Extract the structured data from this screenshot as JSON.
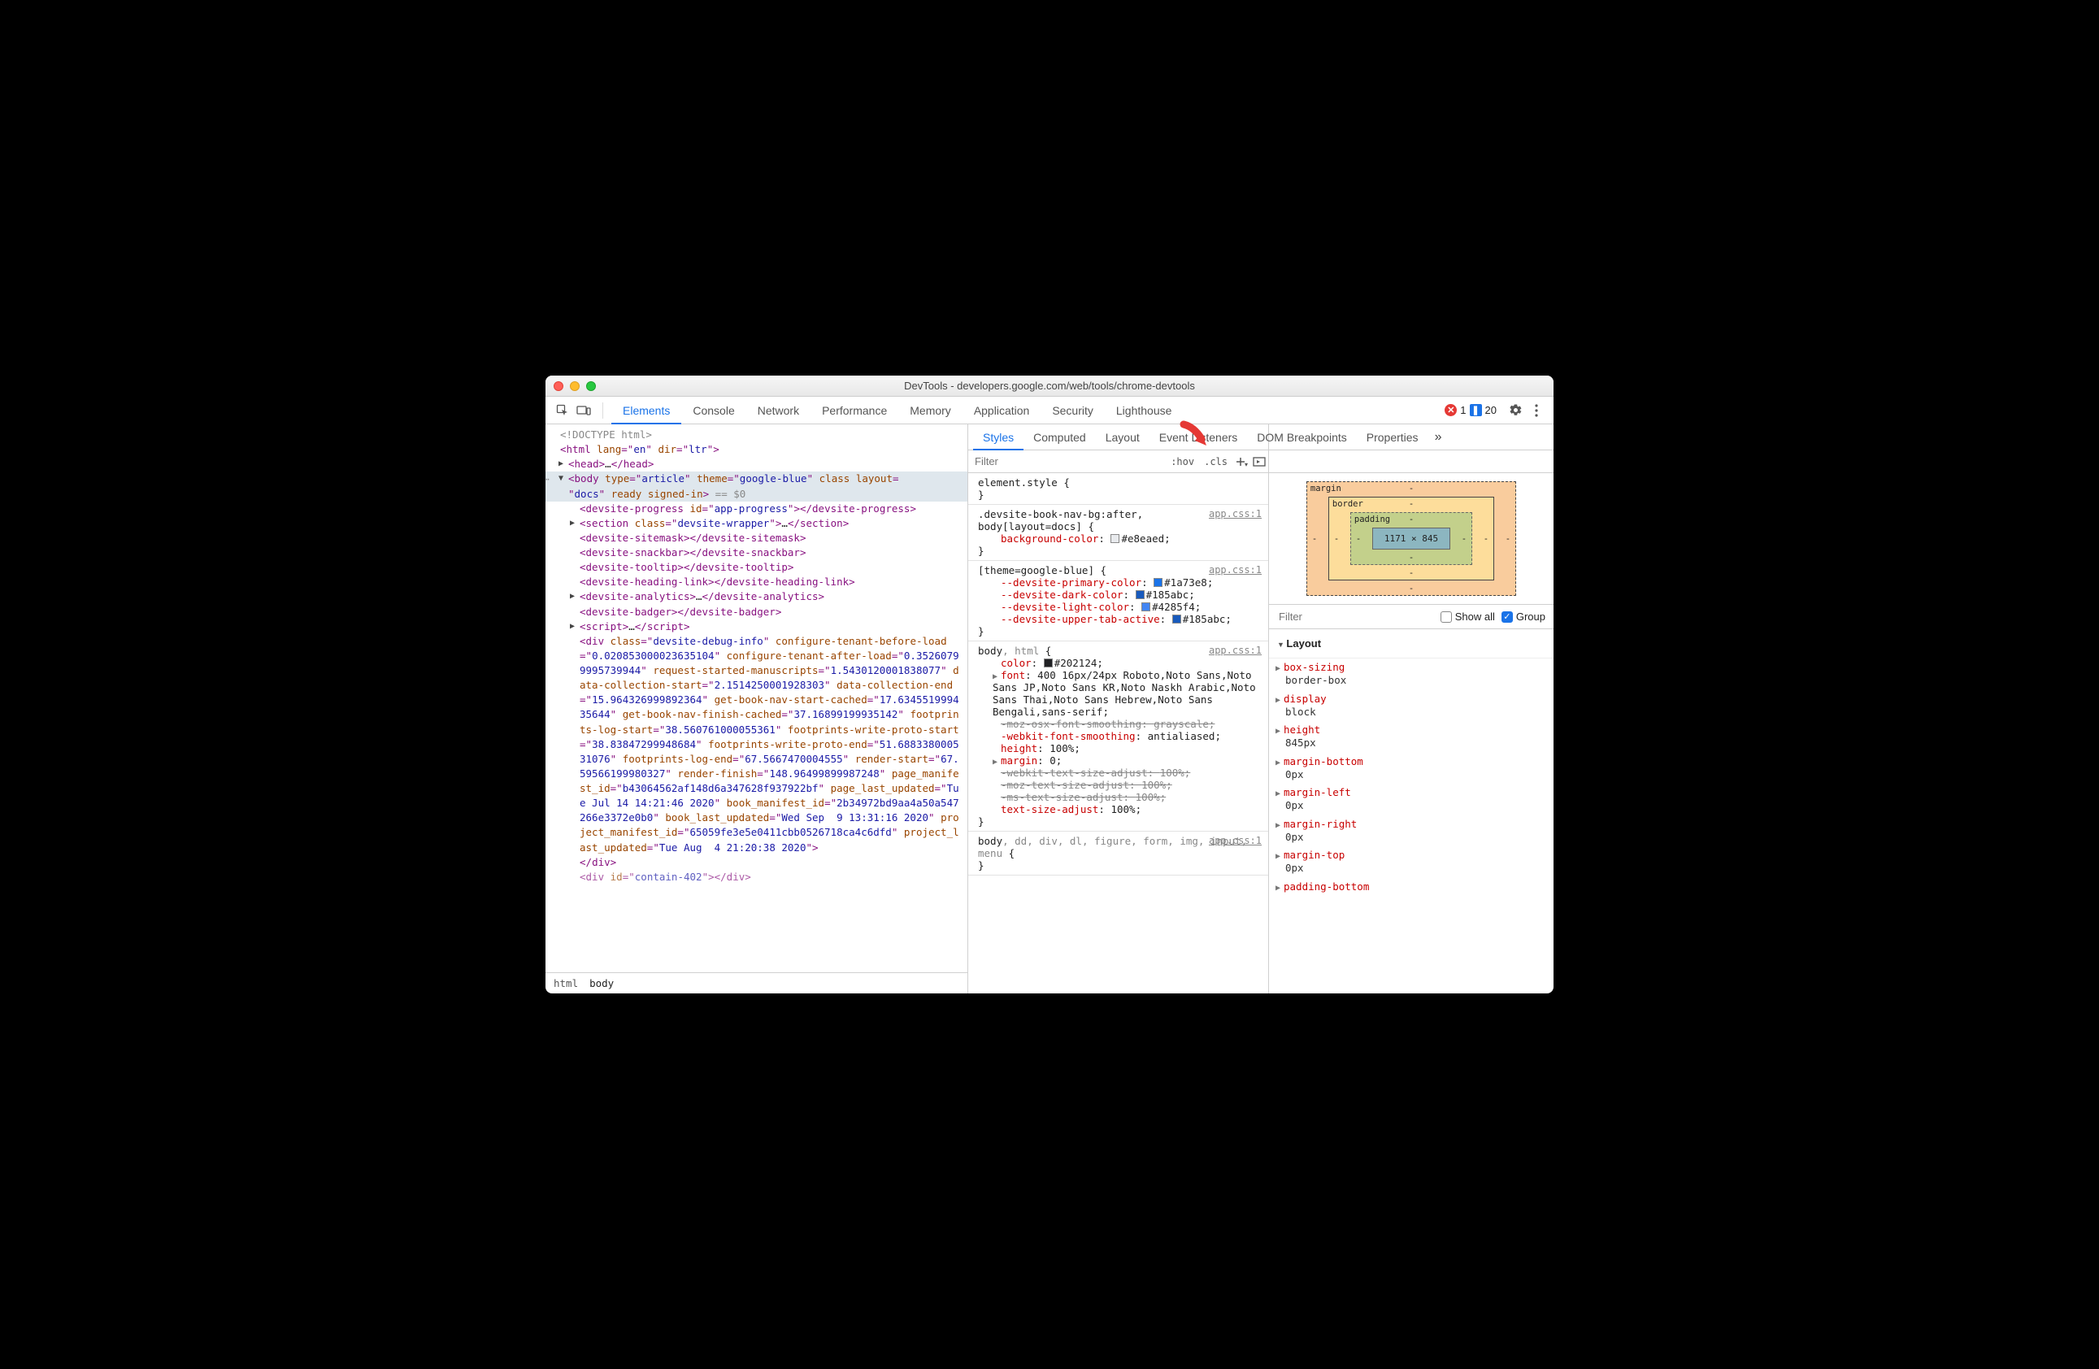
{
  "window": {
    "title": "DevTools - developers.google.com/web/tools/chrome-devtools"
  },
  "errors": {
    "error_count": "1",
    "message_count": "20"
  },
  "main_tabs": [
    "Elements",
    "Console",
    "Network",
    "Performance",
    "Memory",
    "Application",
    "Security",
    "Lighthouse"
  ],
  "main_tabs_active": 0,
  "sub_tabs": [
    "Styles",
    "Computed",
    "Layout",
    "Event Listeners",
    "DOM Breakpoints",
    "Properties"
  ],
  "sub_tabs_active": 0,
  "styles_filter_placeholder": "Filter",
  "styles_toolbar": {
    "hov": ":hov",
    "cls": ".cls"
  },
  "breadcrumbs": [
    "html",
    "body"
  ],
  "dom": {
    "l1": "<!DOCTYPE html>",
    "l2a": "html",
    "l2_lang": "lang",
    "l2_langv": "en",
    "l2_dir": "dir",
    "l2_dirv": "ltr",
    "l3a": "head",
    "l3b": "…",
    "body_attrs": {
      "type": "type",
      "type_v": "article",
      "theme": "theme",
      "theme_v": "google-blue",
      "cls": "class",
      "layout": "layout",
      "layout_v": "docs",
      "ready": "ready",
      "signed": "signed-in",
      "eq": "== $0"
    },
    "children": {
      "progress_open": "<devsite-progress id=\"app-progress\"></devsite-progress>",
      "section": "<section class=\"devsite-wrapper\">…</section>",
      "sitemask": "<devsite-sitemask></devsite-sitemask>",
      "snackbar": "<devsite-snackbar></devsite-snackbar>",
      "tooltip": "<devsite-tooltip></devsite-tooltip>",
      "heading": "<devsite-heading-link></devsite-heading-link>",
      "analytics": "<devsite-analytics>…</devsite-analytics>",
      "badger": "<devsite-badger></devsite-badger>",
      "script": "<script>…</﻿script>",
      "debug_vals": {
        "class": "devsite-debug-info",
        "ctbl": "0.020853000023635104",
        "ctal": "0.35260799995739944",
        "rsm": "1.5430120001838077",
        "dcs": "2.1514250001928303",
        "dce": "15.964326999892364",
        "gbnsc": "17.634551999435644",
        "gbnfc": "37.16899199935142",
        "fls": "38.560761000055361",
        "fwps": "38.83847299948684",
        "fwpe": "51.688338000531076",
        "fle": "67.5667470004555",
        "rs": "67.59566199980327",
        "rf": "148.96499899987248",
        "pmid": "b43064562af148d6a347628f937922bf",
        "plu": "Tue Jul 14 14:21:46 2020",
        "bmid": "2b34972bd9aa4a50a547266e3372e0b0",
        "blu": "Wed Sep  9 13:31:16 2020",
        "prmid": "65059fe3e5e0411cbb0526718ca4c6dfd",
        "prlu": "Tue Aug  4 21:20:38 2020"
      },
      "contain": "<div id=\"contain-402\"></div>"
    }
  },
  "styles": {
    "rules": [
      {
        "selector": "element.style",
        "src": "",
        "props": []
      },
      {
        "selector_html": ".devsite-book-nav-bg:after,<br>body[layout=docs]",
        "src": "app.css:1",
        "props": [
          {
            "n": "background-color",
            "v": "#e8eaed",
            "sw": "#e8eaed"
          }
        ]
      },
      {
        "selector": "[theme=google-blue]",
        "src": "app.css:1",
        "props": [
          {
            "n": "--devsite-primary-color",
            "v": "#1a73e8",
            "sw": "#1a73e8",
            "var": true
          },
          {
            "n": "--devsite-dark-color",
            "v": "#185abc",
            "sw": "#185abc",
            "var": true
          },
          {
            "n": "--devsite-light-color",
            "v": "#4285f4",
            "sw": "#4285f4",
            "var": true
          },
          {
            "n": "--devsite-upper-tab-active",
            "v": "#185abc",
            "sw": "#185abc",
            "var": true
          }
        ]
      },
      {
        "selector_html": "body<span class='sel-dim'>, html</span>",
        "src": "app.css:1",
        "props": [
          {
            "n": "color",
            "v": "#202124",
            "sw": "#202124"
          },
          {
            "n": "font",
            "v": "400 16px/24px Roboto,Noto Sans,Noto Sans JP,Noto Sans KR,Noto Naskh Arabic,Noto Sans Thai,Noto Sans Hebrew,Noto Sans Bengali,sans-serif",
            "expand": true
          },
          {
            "n": "-moz-osx-font-smoothing",
            "v": "grayscale",
            "strike": true
          },
          {
            "n": "-webkit-font-smoothing",
            "v": "antialiased"
          },
          {
            "n": "height",
            "v": "100%"
          },
          {
            "n": "margin",
            "v": "0",
            "expand": true
          },
          {
            "n": "-webkit-text-size-adjust",
            "v": "100%",
            "strike": true
          },
          {
            "n": "-moz-text-size-adjust",
            "v": "100%",
            "strike": true
          },
          {
            "n": "-ms-text-size-adjust",
            "v": "100%",
            "strike": true
          },
          {
            "n": "text-size-adjust",
            "v": "100%"
          }
        ]
      },
      {
        "selector_html": "body<span class='sel-dim'>, dd, div, dl, figure, form, img, input, menu</span>",
        "src": "app.css:1",
        "props": []
      }
    ]
  },
  "boxmodel": {
    "margin": "margin",
    "border": "border",
    "padding": "padding",
    "dash": "-",
    "content": "1171 × 845"
  },
  "side": {
    "filter_placeholder": "Filter",
    "showall": "Show all",
    "group": "Group",
    "group_label": "Layout",
    "props": [
      {
        "n": "box-sizing",
        "v": "border-box"
      },
      {
        "n": "display",
        "v": "block"
      },
      {
        "n": "height",
        "v": "845px"
      },
      {
        "n": "margin-bottom",
        "v": "0px"
      },
      {
        "n": "margin-left",
        "v": "0px"
      },
      {
        "n": "margin-right",
        "v": "0px"
      },
      {
        "n": "margin-top",
        "v": "0px"
      },
      {
        "n": "padding-bottom",
        "v": ""
      }
    ]
  }
}
